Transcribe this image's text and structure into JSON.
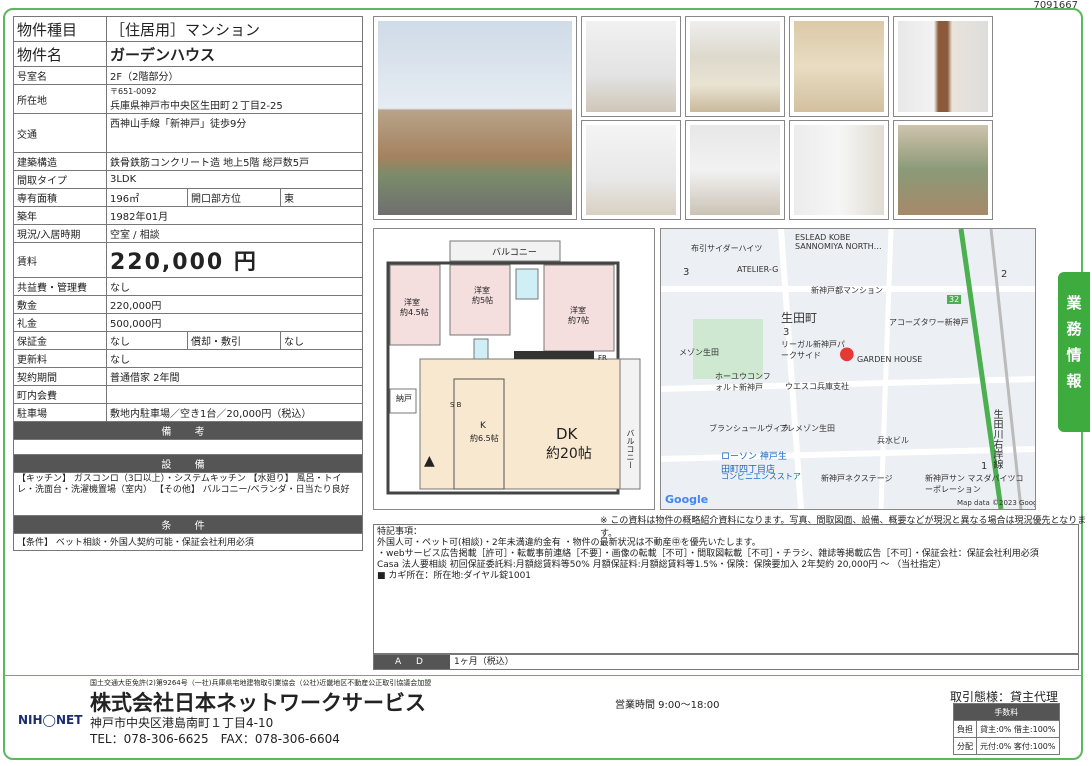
{
  "doc_id": "7091667",
  "spec": {
    "type_label": "物件種目",
    "type_value": "［住居用］マンション",
    "name_label": "物件名",
    "name_value": "ガーデンハウス",
    "room_label": "号室名",
    "room_value": "2F（2階部分）",
    "address_label": "所在地",
    "postal": "〒651-0092",
    "address_value": "兵庫県神戸市中央区生田町２丁目2-25",
    "access_label": "交通",
    "access_value": "西神山手線「新神戸」徒歩9分",
    "structure_label": "建築構造",
    "structure_value": "鉄骨鉄筋コンクリート造 地上5階 総戸数5戸",
    "layout_label": "間取タイプ",
    "layout_value": "3LDK",
    "area_label": "専有面積",
    "area_value": "196㎡",
    "dir_label": "開口部方位",
    "dir_value": "東",
    "built_label": "築年",
    "built_value": "1982年01月",
    "status_label": "現況/入居時期",
    "status_value": "空室 / 相談",
    "rent_label": "賃料",
    "rent_value": "220,000 円",
    "common_label": "共益費・管理費",
    "common_value": "なし",
    "deposit_label": "敷金",
    "deposit_value": "220,000円",
    "key_label": "礼金",
    "key_value": "500,000円",
    "guarantee_label": "保証金",
    "guarantee_value": "なし",
    "amort_label": "償却・敷引",
    "amort_value": "なし",
    "renewal_label": "更新料",
    "renewal_value": "なし",
    "contract_label": "契約期間",
    "contract_value": "普通借家 2年間",
    "assoc_label": "町内会費",
    "assoc_value": "",
    "parking_label": "駐車場",
    "parking_value": "敷地内駐車場／空き1台／20,000円（税込）",
    "remarks_label": "備 考",
    "remarks_value": "",
    "equip_label": "設 備",
    "equip_value": "【キッチン】 ガスコンロ（3口以上）・システムキッチン 【水廻り】 風呂・トイレ・洗面台・洗濯機置場（室内） 【その他】 バルコニー/ベランダ・日当たり良好",
    "cond_label": "条 件",
    "cond_value": "【条件】 ベット相談・外国人契約可能・保証会社利用必須"
  },
  "plan": {
    "balcony_top": "バルコニー",
    "room1": "洋室",
    "room1_size": "約4.5帖",
    "room2": "洋室",
    "room2_size": "約5帖",
    "room3": "洋室",
    "room3_size": "約7帖",
    "storage": "納戸",
    "sb": "S B",
    "kitchen": "K",
    "kitchen_size": "約6.5帖",
    "dk": "DK",
    "dk_size": "約20帖",
    "balcony_side": "バルコニー",
    "fr": "FR"
  },
  "map": {
    "labels": [
      "布引サイダーハイツ",
      "ESLEAD KOBE SANNOMIYA NORTH…",
      "ATELIER-G",
      "新神戸都マンション",
      "生田町",
      "アコーズタワー新神戸",
      "メゾン生田",
      "リーガル新神戸パークサイド",
      "GARDEN HOUSE",
      "ホーユウコンフォルト新神戸",
      "ウエスコ兵庫支社",
      "ブランシュールヴィラ",
      "プレメゾン生田",
      "兵水ビル",
      "ローソン 神戸生田町四丁目店",
      "コンビニエンスストア",
      "新神戸ネクステージ",
      "新神戸サン マスダパイツコーポレーション",
      "生田川右岸線",
      "32",
      "3",
      "3",
      "2",
      "1",
      "Google",
      "Map data ©2023 Google"
    ]
  },
  "caption": "※ この資料は物件の概略紹介資料になります。写真、間取図面、設備、概要などが現況と異なる場合は現況優先となります。",
  "notes": {
    "title": "特記事項：",
    "lines": [
      "外国人可・ペット可(相談)・2年未満違約金有 ・物件の最新状況は不動産㊥を優先いたします。",
      "・webサービス広告掲載［許可］・転載事前連絡［不要］・画像の転載［不可］・間取図転載［不可］・チラシ、雑誌等掲載広告［不可］・保証会社：保証会社利用必須",
      "Casa 法人要相談 初回保証委託料:月額総賃料等50% 月額保証料:月額総賃料等1.5%・保険：保険要加入 2年契約 20,000円 ～ （当社指定）",
      "■ カギ所在：所在地:ダイヤル錠1001"
    ]
  },
  "ad": {
    "label": "A D",
    "value": "1ヶ月（税込）"
  },
  "footer": {
    "license": "国土交通大臣免許(2)第9264号（一社)兵庫県宅地建物取引業協会（公社)近畿地区不動産公正取引協議会加盟",
    "logo": "NIH◯NET",
    "company": "株式会社日本ネットワークサービス",
    "address": "神戸市中央区港島南町１丁目4-10",
    "tel": "TEL：078-306-6625　FAX：078-306-6604",
    "hours": "営業時間 9:00～18:00",
    "deal": "取引態様：貸主代理",
    "fee_header": "手数料",
    "fee_row1_label": "負担",
    "fee_row1_value": "貸主:0% 借主:100%",
    "fee_row2_label": "分配",
    "fee_row2_value": "元付:0% 客付:100%"
  },
  "side_tab": [
    "業",
    "務",
    "情",
    "報"
  ]
}
